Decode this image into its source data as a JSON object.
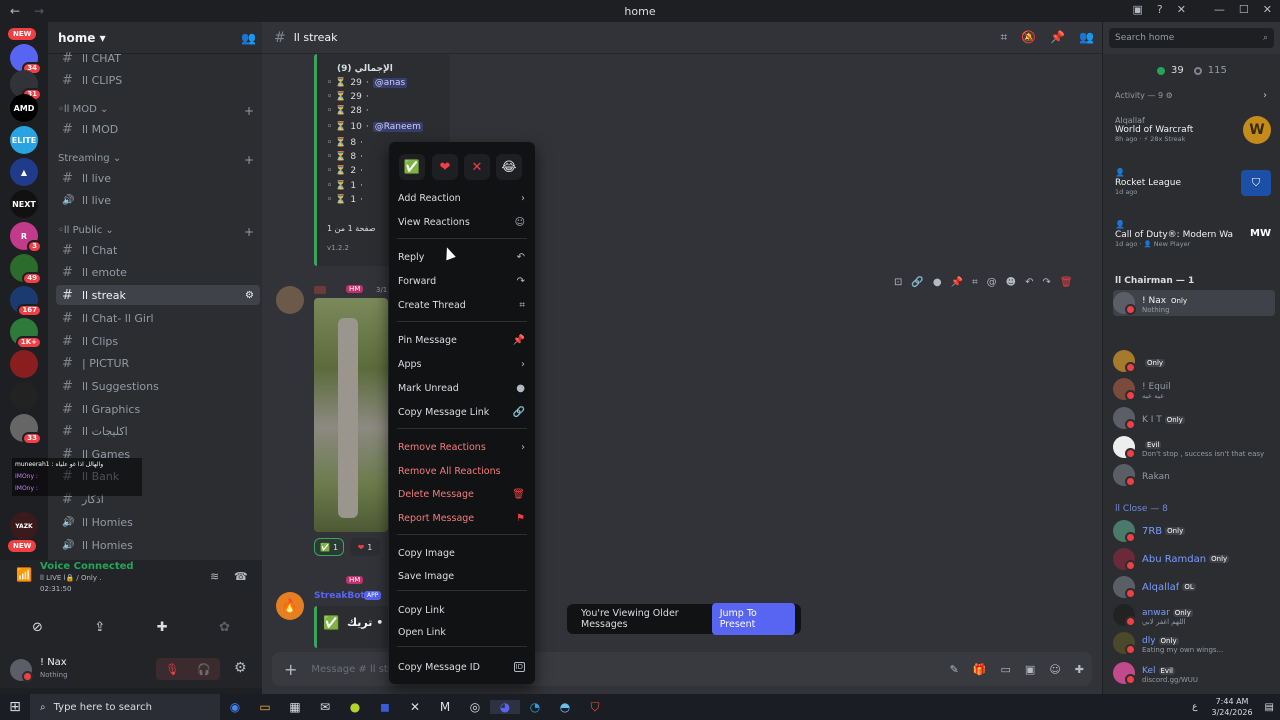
{
  "window": {
    "title": "home",
    "back": "←",
    "forward": "→"
  },
  "server_rail": {
    "new_top": "NEW",
    "new_bottom": "NEW",
    "badges": [
      "34",
      "31",
      "3",
      "49",
      "167",
      "1K+",
      "33"
    ],
    "server_labels": [
      "AMD",
      "ELITE",
      "NEXT",
      "R",
      "YAZK"
    ]
  },
  "sidebar": {
    "server_name": "home ▾",
    "categories": {
      "mod": "◦ll MOD ⌄",
      "streaming": "Streaming ⌄",
      "public": "◦ll Public ⌄"
    },
    "channels": [
      {
        "label": "ll CHAT",
        "icon": "#"
      },
      {
        "label": "ll CLIPS",
        "icon": "#"
      },
      {
        "label": "ll MOD",
        "icon": "#"
      },
      {
        "label": "ll live",
        "icon": "#"
      },
      {
        "label": "ll live",
        "icon": "🔊"
      },
      {
        "label": "ll Chat",
        "icon": "#"
      },
      {
        "label": "ll emote",
        "icon": "#"
      },
      {
        "label": "ll streak",
        "icon": "#"
      },
      {
        "label": "ll Chat- ll Girl",
        "icon": "#"
      },
      {
        "label": "ll Clips",
        "icon": "#"
      },
      {
        "label": "| PICTUR",
        "icon": "#"
      },
      {
        "label": "ll Suggestions",
        "icon": "#"
      },
      {
        "label": "ll Graphics",
        "icon": "#"
      },
      {
        "label": "ll اكليجات",
        "icon": "#"
      },
      {
        "label": "ll Games",
        "icon": "#"
      },
      {
        "label": "ll Bank",
        "icon": "#"
      },
      {
        "label": "اذكار",
        "icon": "#"
      },
      {
        "label": "ll Homies",
        "icon": "🔊"
      },
      {
        "label": "ll Homies",
        "icon": "🔊"
      }
    ],
    "overlay_lines": [
      "muneerah1 : والهالل اذا غو علياه",
      "IMOny :",
      "IMOny :"
    ]
  },
  "voice": {
    "status": "Voice Connected",
    "channel": "ll LIVE l🔒 / Only .",
    "time": "02:31:50"
  },
  "user": {
    "name": "! Nax",
    "status": "Nothing"
  },
  "main": {
    "channel_name": "ll streak",
    "embed_title": "الإجمالي (9)",
    "leaderboard": [
      {
        "count": "29",
        "user": "@anas"
      },
      {
        "count": "29",
        "user": ""
      },
      {
        "count": "28",
        "user": ""
      },
      {
        "count": "10",
        "user": "@Raneem"
      },
      {
        "count": "8",
        "user": ""
      },
      {
        "count": "8",
        "user": ""
      },
      {
        "count": "2",
        "user": ""
      },
      {
        "count": "1",
        "user": ""
      },
      {
        "count": "1",
        "user": ""
      }
    ],
    "page_info": "صفحة 1 من 1",
    "version": "v1.2.2",
    "msg_tag": "HM",
    "msg_date": "3/1",
    "reaction_counts": [
      "1",
      "1"
    ],
    "bot_name": "StreakBot",
    "bot_tag": "APP",
    "bot_tag2": "HM",
    "bot_text": "تريك •",
    "composer_placeholder": "Message # ll str",
    "older_messages": "You're Viewing Older Messages",
    "jump_button": "Jump To Present"
  },
  "context_menu": {
    "quick_reactions": [
      "✅",
      "❤",
      "✕",
      "😂"
    ],
    "items": [
      {
        "label": "Add Reaction",
        "icon": "›",
        "color": "normal"
      },
      {
        "label": "View Reactions",
        "icon": "☺",
        "color": "normal"
      },
      {
        "label": "Reply",
        "icon": "↶",
        "color": "normal"
      },
      {
        "label": "Forward",
        "icon": "↷",
        "color": "normal"
      },
      {
        "label": "Create Thread",
        "icon": "⌗",
        "color": "normal"
      },
      {
        "label": "Pin Message",
        "icon": "📌",
        "color": "normal"
      },
      {
        "label": "Apps",
        "icon": "›",
        "color": "normal"
      },
      {
        "label": "Mark Unread",
        "icon": "●",
        "color": "normal"
      },
      {
        "label": "Copy Message Link",
        "icon": "🔗",
        "color": "normal"
      },
      {
        "label": "Remove Reactions",
        "icon": "›",
        "color": "red"
      },
      {
        "label": "Remove All Reactions",
        "icon": "",
        "color": "red"
      },
      {
        "label": "Delete Message",
        "icon": "🗑",
        "color": "red"
      },
      {
        "label": "Report Message",
        "icon": "⚑",
        "color": "red"
      },
      {
        "label": "Copy Image",
        "icon": "",
        "color": "normal"
      },
      {
        "label": "Save Image",
        "icon": "",
        "color": "normal"
      },
      {
        "label": "Copy Link",
        "icon": "",
        "color": "normal"
      },
      {
        "label": "Open Link",
        "icon": "",
        "color": "normal"
      },
      {
        "label": "Copy Message ID",
        "icon": "ID",
        "color": "normal"
      }
    ]
  },
  "members": {
    "search_placeholder": "Search home",
    "online_count": "39",
    "offline_count": "115",
    "activity_header": "Activity — 9 ⚙",
    "activities": [
      {
        "user": "Alqallaf",
        "game": "World of Warcraft",
        "meta": "8h ago · ⚡ 28x Streak"
      },
      {
        "user": "",
        "game": "Rocket League",
        "meta": "1d ago"
      },
      {
        "user": "",
        "game": "Call of Duty®: Modern Warf...",
        "meta": "1d ago · 👤 New Player"
      }
    ],
    "chairman_header": "ll Chairman — 1",
    "chairman": [
      {
        "name": "! Nax",
        "tag": "Only",
        "sub": "Nothing"
      }
    ],
    "king_list": [
      {
        "name": "",
        "tag": "Only",
        "sub": ""
      },
      {
        "name": "! Equil",
        "tag": "",
        "sub": "عيه عيه"
      },
      {
        "name": "K I T",
        "tag": "Only",
        "sub": ""
      },
      {
        "name": "",
        "tag": "Evil",
        "sub": "Don't stop , success isn't that easy"
      },
      {
        "name": "Rakan",
        "tag": "",
        "sub": ""
      }
    ],
    "close_header": "ll Close — 8",
    "close_list": [
      {
        "name": "7RB",
        "tag": "Only",
        "sub": ""
      },
      {
        "name": "Abu Ramdan",
        "tag": "Only",
        "sub": ""
      },
      {
        "name": "Alqallaf",
        "tag": "OL",
        "sub": ""
      },
      {
        "name": "anwar",
        "tag": "Only",
        "sub": "اللهم اغفر لابي"
      },
      {
        "name": "dly",
        "tag": "Only",
        "sub": "Eating my own wings..."
      },
      {
        "name": "Kel",
        "tag": "Evil",
        "sub": "discord.gg/WUU"
      }
    ]
  },
  "taskbar": {
    "search_placeholder": "Type here to search",
    "time": "7:44 AM",
    "date": "3/24/2026",
    "lang": "ع"
  }
}
